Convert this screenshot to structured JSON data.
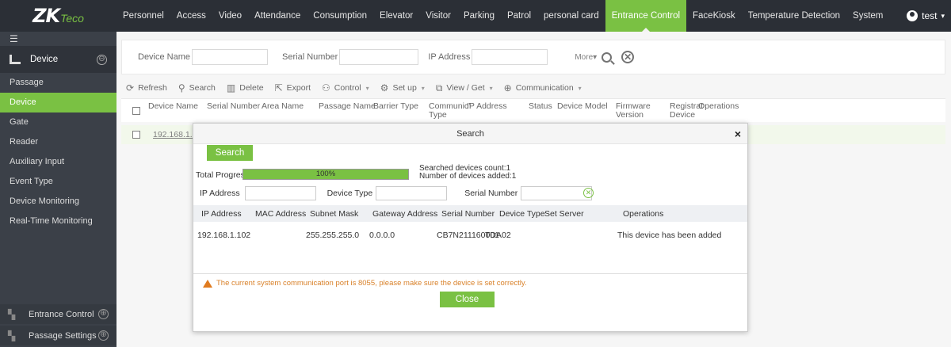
{
  "app": {
    "logo_main": "ZK",
    "logo_sub": "Teco"
  },
  "nav": {
    "items": [
      "Personnel",
      "Access",
      "Video",
      "Attendance",
      "Consumption",
      "Elevator",
      "Visitor",
      "Parking",
      "Patrol",
      "personal card",
      "Entrance Control",
      "FaceKiosk",
      "Temperature Detection",
      "System"
    ],
    "active": "Entrance Control",
    "user": "test",
    "user_caret": "▾"
  },
  "sidebar": {
    "toggle_glyph": "☰",
    "header": "Device",
    "header_glyph": "⊖",
    "items": [
      "Passage",
      "Device",
      "Gate",
      "Reader",
      "Auxiliary Input",
      "Event Type",
      "Device Monitoring",
      "Real-Time Monitoring"
    ],
    "active": "Device",
    "footer": [
      {
        "label": "Entrance Control",
        "glyph": "⊕"
      },
      {
        "label": "Passage Settings",
        "glyph": "⊕"
      }
    ]
  },
  "filter": {
    "device_name_label": "Device Name",
    "serial_number_label": "Serial Number",
    "ip_address_label": "IP Address",
    "more_label": "More▾",
    "clear_glyph": "✕"
  },
  "toolbar": {
    "refresh": "Refresh",
    "search": "Search",
    "delete": "Delete",
    "export": "Export",
    "control": "Control",
    "setup": "Set up",
    "view_get": "View / Get",
    "communication": "Communication",
    "caret": "▾"
  },
  "grid": {
    "columns": [
      "Device Name",
      "Serial Number",
      "Area Name",
      "Passage Name",
      "Barrier Type",
      "Communic’ Type",
      "IP Address",
      "Status",
      "Device Model",
      "Firmware Version",
      "Registrat Device",
      "Operations"
    ],
    "row_link": "192.168.1.10"
  },
  "dialog": {
    "title": "Search",
    "close_glyph": "×",
    "search_button": "Search",
    "total_progress_label": "Total Progress",
    "progress_percent": 100,
    "progress_text": "100%",
    "searched_count": "Searched devices count:1",
    "added_count": "Number of devices added:1",
    "ip_label": "IP Address",
    "device_type_label": "Device Type",
    "serial_label": "Serial Number",
    "refresh_glyph": "✕",
    "columns": [
      "IP Address",
      "MAC Address",
      "Subnet Mask",
      "Gateway Address",
      "Serial Number",
      "Device Type",
      "Set Server",
      "Operations"
    ],
    "rows": [
      {
        "ip": "192.168.1.102",
        "mac": "",
        "subnet": "255.255.255.0",
        "gateway": "0.0.0.0",
        "serial": "CB7N211160001",
        "type": "TDA02",
        "server": "",
        "operation": "This device has been added"
      }
    ],
    "warning": "The current system communication port is 8055, please make sure the device is set correctly.",
    "close_button": "Close"
  },
  "colors": {
    "accent": "#7ac143",
    "topbar": "#2b2f36",
    "sidebar": "#3b4048",
    "warning": "#e07b1f"
  }
}
